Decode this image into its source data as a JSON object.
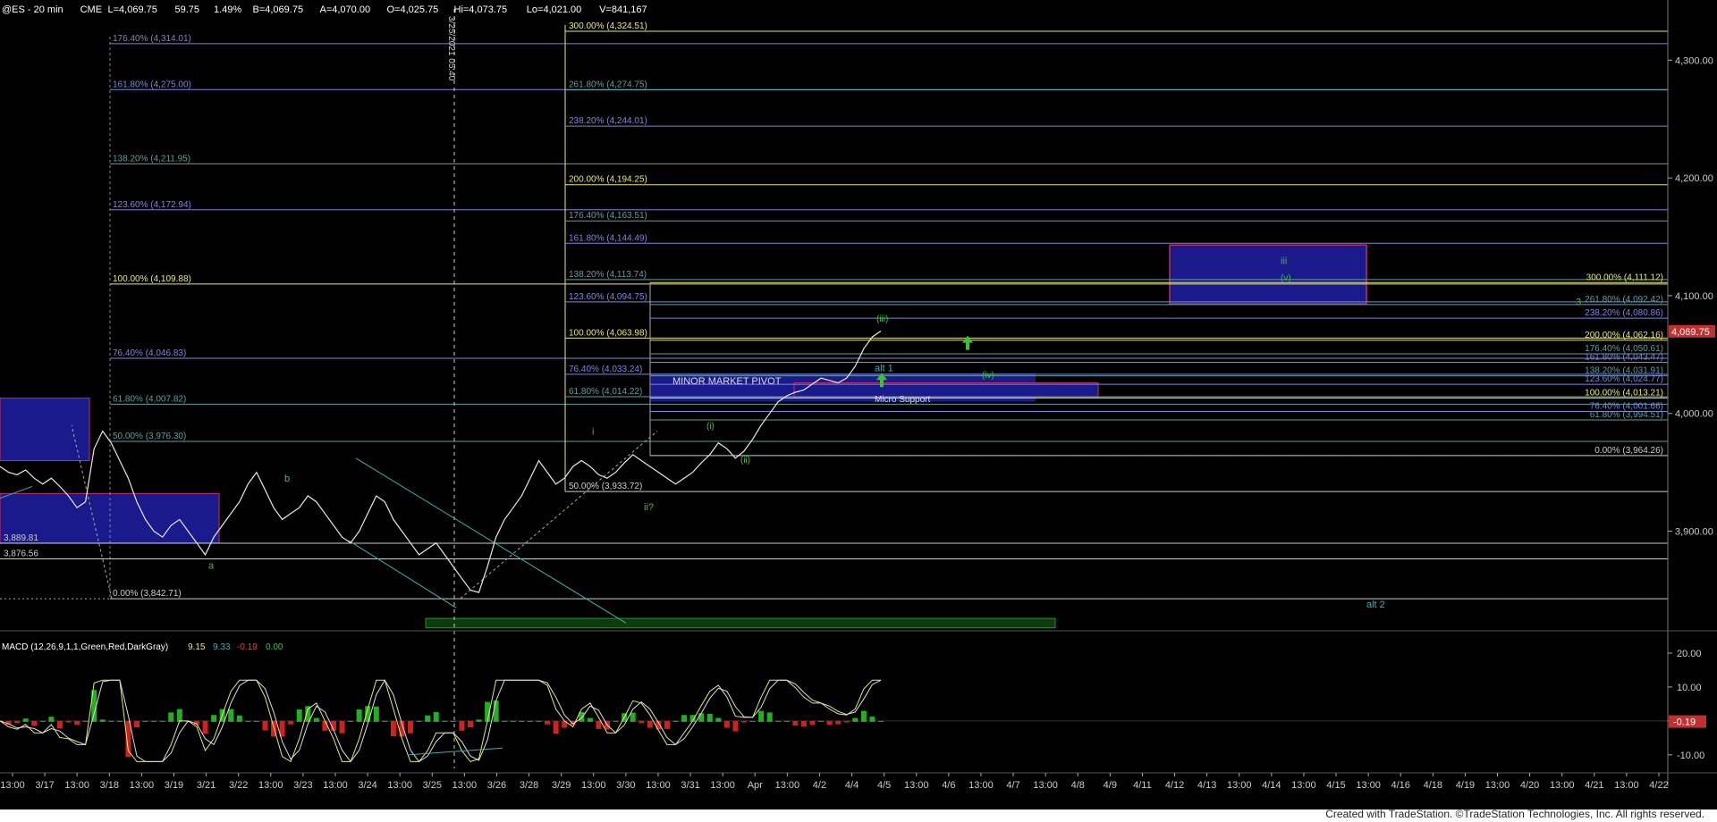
{
  "header": {
    "symbol": "@ES - 20 min",
    "exchange": "CME",
    "last": "L=4,069.75",
    "change": "59.75",
    "change_pct": "1.49%",
    "bid": "B=4,069.75",
    "ask": "A=4,070.00",
    "open": "O=4,025.75",
    "high": "Hi=4,073.75",
    "low": "Lo=4,021.00",
    "volume": "V=841,167"
  },
  "footer": "Created with TradeStation. ©TradeStation Technologies, Inc. All rights reserved.",
  "price_axis": {
    "ticks": [
      3900,
      4000,
      4100,
      4200,
      4300
    ],
    "tick_labels": [
      "3,900.00",
      "4,000.00",
      "4,100.00",
      "4,200.00",
      "4,300.00"
    ],
    "last_price_label": "4,069.75",
    "ylim": [
      3820,
      4345
    ]
  },
  "macd_axis": {
    "ticks": [
      -10,
      0,
      10,
      20
    ],
    "tick_labels": [
      "-10.00",
      "",
      "10.00",
      "20.00"
    ],
    "current_label": "-0.19",
    "ylim": [
      -14,
      25
    ]
  },
  "time_axis": {
    "labels": [
      "13:00",
      "3/17",
      "13:00",
      "3/18",
      "13:00",
      "3/19",
      "3/21",
      "3/22",
      "13:00",
      "3/23",
      "13:00",
      "3/24",
      "13:00",
      "3/25",
      "13:00",
      "3/26",
      "3/28",
      "3/29",
      "13:00",
      "3/30",
      "13:00",
      "3/31",
      "13:00",
      "Apr",
      "13:00",
      "4/2",
      "4/4",
      "4/5",
      "13:00",
      "4/6",
      "13:00",
      "4/7",
      "13:00",
      "4/8",
      "4/9",
      "4/11",
      "4/12",
      "4/13",
      "13:00",
      "4/14",
      "13:00",
      "4/15",
      "13:00",
      "4/16",
      "4/18",
      "4/19",
      "13:00",
      "4/20",
      "13:00",
      "4/21",
      "13:00",
      "4/22"
    ]
  },
  "vertical_marker": "3/25/2021 05:40",
  "fib_levels_left": [
    {
      "label": "176.40% (4,314.01)",
      "value": 4314.01,
      "color": "#7f85b8"
    },
    {
      "label": "161.80% (4,275.00)",
      "value": 4275.0,
      "color": "#7f85e0"
    },
    {
      "label": "138.20% (4,211.95)",
      "value": 4211.95,
      "color": "#5f9f9f"
    },
    {
      "label": "123.60% (4,172.94)",
      "value": 4172.94,
      "color": "#7f85e0"
    },
    {
      "label": "100.00% (4,109.88)",
      "value": 4109.88,
      "color": "#e8e870"
    },
    {
      "label": "76.40% (4,046.83)",
      "value": 4046.83,
      "color": "#7f85e0"
    },
    {
      "label": "61.80% (4,007.82)",
      "value": 4007.82,
      "color": "#5f9f9f"
    },
    {
      "label": "50.00% (3,976.30)",
      "value": 3976.3,
      "color": "#5f9f9f"
    },
    {
      "label": "0.00% (3,842.71)",
      "value": 3842.71,
      "color": "#cccccc"
    }
  ],
  "fib_levels_mid": [
    {
      "label": "300.00% (4,324.51)",
      "value": 4324.51,
      "color": "#e8e870"
    },
    {
      "label": "261.80% (4,274.75)",
      "value": 4274.75,
      "color": "#5f9f9f"
    },
    {
      "label": "238.20% (4,244.01)",
      "value": 4244.01,
      "color": "#7f85e0"
    },
    {
      "label": "200.00% (4,194.25)",
      "value": 4194.25,
      "color": "#e8e870"
    },
    {
      "label": "176.40% (4,163.51)",
      "value": 4163.51,
      "color": "#5f9f9f"
    },
    {
      "label": "161.80% (4,144.49)",
      "value": 4144.49,
      "color": "#7f85e0"
    },
    {
      "label": "138.20% (4,113.74)",
      "value": 4113.74,
      "color": "#5f9f9f"
    },
    {
      "label": "123.60% (4,094.75)",
      "value": 4094.75,
      "color": "#7f85e0"
    },
    {
      "label": "100.00% (4,063.98)",
      "value": 4063.98,
      "color": "#e8e870"
    },
    {
      "label": "76.40% (4,033.24)",
      "value": 4033.24,
      "color": "#7f85e0"
    },
    {
      "label": "61.80% (4,014.22)",
      "value": 4014.22,
      "color": "#5f9f9f"
    },
    {
      "label": "50.00% (3,933.72)",
      "value": 3933.72,
      "color": "#cccccc"
    }
  ],
  "fib_levels_right": [
    {
      "label": "300.00% (4,111.12)",
      "value": 4111.12,
      "color": "#e8e870"
    },
    {
      "label": "261.80% (4,092.42)",
      "value": 4092.42,
      "color": "#5f9f9f"
    },
    {
      "label": "238.20% (4,080.86)",
      "value": 4080.86,
      "color": "#7f85e0"
    },
    {
      "label": "200.00% (4,062.16)",
      "value": 4062.16,
      "color": "#e8e870"
    },
    {
      "label": "176.40% (4,050.61)",
      "value": 4050.61,
      "color": "#5f9f9f"
    },
    {
      "label": "161.80% (4,043.47)",
      "value": 4043.47,
      "color": "#7f85e0"
    },
    {
      "label": "138.20% (4,031.91)",
      "value": 4031.91,
      "color": "#5f9f9f"
    },
    {
      "label": "123.60% (4,024.77)",
      "value": 4024.77,
      "color": "#7f85e0"
    },
    {
      "label": "100.00% (4,013.21)",
      "value": 4013.21,
      "color": "#e8e870"
    },
    {
      "label": "76.40% (4,001.66)",
      "value": 4001.66,
      "color": "#7f85e0"
    },
    {
      "label": "61.80% (3,994.51)",
      "value": 3994.51,
      "color": "#5f9f9f"
    },
    {
      "label": "0.00% (3,964.26)",
      "value": 3964.26,
      "color": "#cccccc"
    }
  ],
  "other_levels": [
    {
      "label": "3,889.81",
      "value": 3889.81
    },
    {
      "label": "3,876.56",
      "value": 3876.56
    }
  ],
  "annotations": {
    "minor_market_pivot": "MINOR MARKET PIVOT",
    "micro_support": "Micro Support",
    "alt1": "alt 1",
    "alt2": "alt 2",
    "wave_iii_target": "iii",
    "wave_v_target": "(v)",
    "wave_iii_small": "(iii)",
    "wave_iv_small": "(iv)",
    "wave_i_small": "(i)",
    "wave_ii_small": "(ii)",
    "wave_i": "i",
    "wave_ii": "ii?",
    "wave_a": "a",
    "wave_b": "b",
    "wave_3": "3"
  },
  "macd": {
    "label": "MACD (12,26,9,1,1,Green,Red,DarkGray)",
    "v1": "9.15",
    "v2": "9.33",
    "v3": "-0.19",
    "v4": "0.00"
  },
  "chart_data": {
    "type": "line",
    "title": "@ES - 20 min",
    "ylim": [
      3820,
      4345
    ],
    "series": [
      {
        "name": "",
        "values": [
          3955,
          3950,
          3948,
          3952,
          3945,
          3940,
          3945,
          3938,
          3930,
          3920,
          3925,
          3970,
          3985,
          3975,
          3960,
          3945,
          3925,
          3910,
          3900,
          3895,
          3905,
          3910,
          3900,
          3890,
          3880,
          3895,
          3905,
          3915,
          3925,
          3940,
          3950,
          3935,
          3920,
          3910,
          3915,
          3920,
          3930,
          3925,
          3915,
          3905,
          3895,
          3890,
          3900,
          3915,
          3930,
          3925,
          3910,
          3900,
          3890,
          3880,
          3885,
          3890,
          3880,
          3870,
          3860,
          3850,
          3848,
          3870,
          3895,
          3910,
          3920,
          3930,
          3945,
          3960,
          3950,
          3940,
          3945,
          3955,
          3960,
          3955,
          3948,
          3945,
          3950,
          3958,
          3965,
          3960,
          3955,
          3950,
          3945,
          3940,
          3945,
          3950,
          3958,
          3965,
          3975,
          3970,
          3962,
          3968,
          3978,
          3990,
          4000,
          4010,
          4015,
          4018,
          4020,
          4025,
          4030,
          4028,
          4026,
          4030,
          4040,
          4055,
          4065,
          4070
        ]
      }
    ]
  }
}
